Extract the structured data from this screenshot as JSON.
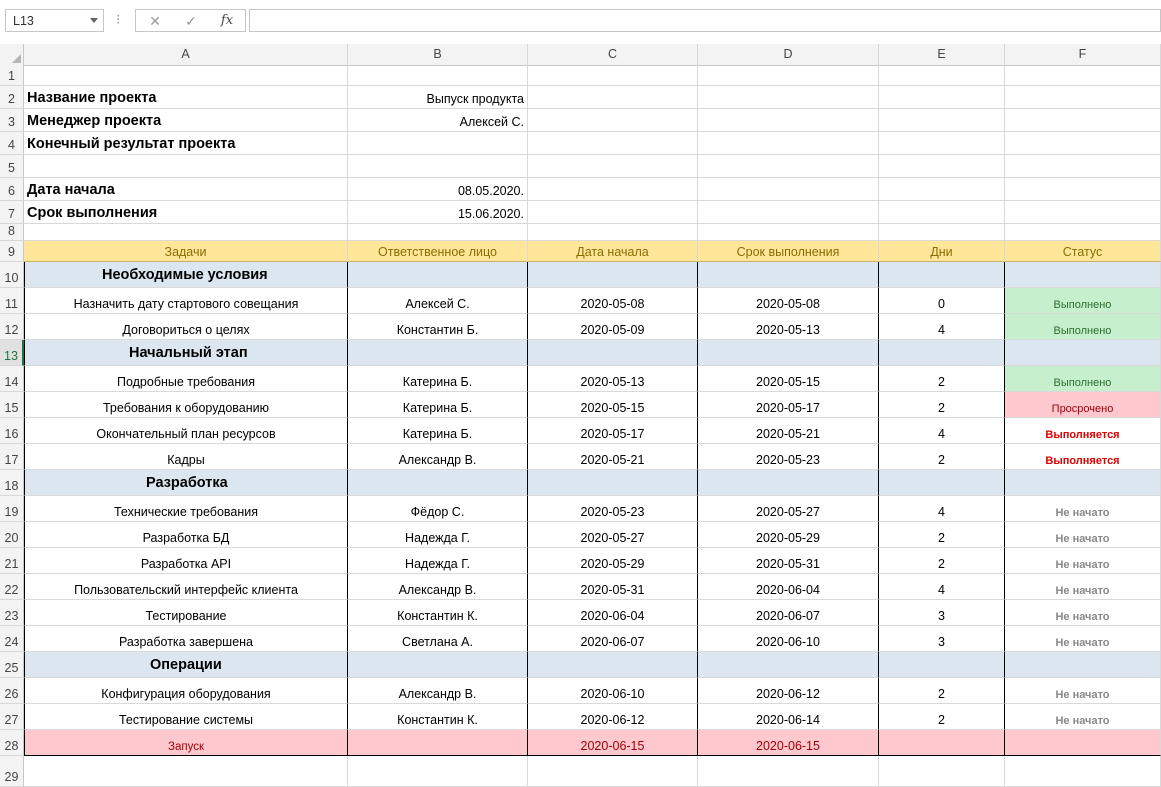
{
  "namebox": {
    "value": "L13"
  },
  "formula": {
    "value": ""
  },
  "columns": [
    "A",
    "B",
    "C",
    "D",
    "E",
    "F"
  ],
  "rows": [
    "1",
    "2",
    "3",
    "4",
    "5",
    "6",
    "7",
    "8",
    "9",
    "10",
    "11",
    "12",
    "13",
    "14",
    "15",
    "16",
    "17",
    "18",
    "19",
    "20",
    "21",
    "22",
    "23",
    "24",
    "25",
    "26",
    "27",
    "28",
    "29"
  ],
  "info": {
    "project_name_label": "Название проекта",
    "project_name_value": "Выпуск продукта",
    "manager_label": "Менеджер проекта",
    "manager_value": "Алексей С.",
    "result_label": "Конечный результат проекта",
    "start_label": "Дата начала",
    "start_value": "08.05.2020.",
    "deadline_label": "Срок выполнения",
    "deadline_value": "15.06.2020."
  },
  "table_header": [
    "Задачи",
    "Ответственное лицо",
    "Дата начала",
    "Срок выполнения",
    "Дни",
    "Статус"
  ],
  "sections": {
    "s10": "Необходимые условия",
    "s13": "Начальный этап",
    "s18": "Разработка",
    "s25": "Операции"
  },
  "tasks": {
    "r11": [
      "Назначить дату стартового совещания",
      "Алексей С.",
      "2020-05-08",
      "2020-05-08",
      "0",
      "Выполнено"
    ],
    "r12": [
      "Договориться о целях",
      "Константин Б.",
      "2020-05-09",
      "2020-05-13",
      "4",
      "Выполнено"
    ],
    "r14": [
      "Подробные требования",
      "Катерина Б.",
      "2020-05-13",
      "2020-05-15",
      "2",
      "Выполнено"
    ],
    "r15": [
      "Требования к оборудованию",
      "Катерина Б.",
      "2020-05-15",
      "2020-05-17",
      "2",
      "Просрочено"
    ],
    "r16": [
      "Окончательный план ресурсов",
      "Катерина Б.",
      "2020-05-17",
      "2020-05-21",
      "4",
      "Выполняется"
    ],
    "r17": [
      "Кадры",
      "Александр В.",
      "2020-05-21",
      "2020-05-23",
      "2",
      "Выполняется"
    ],
    "r19": [
      "Технические требования",
      "Фёдор С.",
      "2020-05-23",
      "2020-05-27",
      "4",
      "Не начато"
    ],
    "r20": [
      "Разработка БД",
      "Надежда Г.",
      "2020-05-27",
      "2020-05-29",
      "2",
      "Не начато"
    ],
    "r21": [
      "Разработка API",
      "Надежда Г.",
      "2020-05-29",
      "2020-05-31",
      "2",
      "Не начато"
    ],
    "r22": [
      "Пользовательский интерфейс клиента",
      "Александр В.",
      "2020-05-31",
      "2020-06-04",
      "4",
      "Не начато"
    ],
    "r23": [
      "Тестирование",
      "Константин К.",
      "2020-06-04",
      "2020-06-07",
      "3",
      "Не начато"
    ],
    "r24": [
      "Разработка завершена",
      "Светлана А.",
      "2020-06-07",
      "2020-06-10",
      "3",
      "Не начато"
    ],
    "r26": [
      "Конфигурация оборудования",
      "Александр В.",
      "2020-06-10",
      "2020-06-12",
      "2",
      "Не начато"
    ],
    "r27": [
      "Тестирование системы",
      "Константин К.",
      "2020-06-12",
      "2020-06-14",
      "2",
      "Не начато"
    ],
    "r28": [
      "Запуск",
      "",
      "2020-06-15",
      "2020-06-15",
      "",
      ""
    ]
  },
  "colors": {
    "header_fill": "#ffe699",
    "section_fill": "#dce6f0",
    "done_fill": "#c6efce",
    "late_fill": "#ffc7ce",
    "accent": "#217346"
  }
}
